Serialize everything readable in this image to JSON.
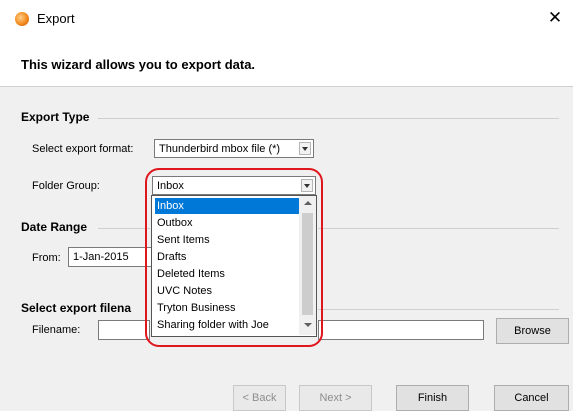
{
  "window": {
    "title": "Export",
    "close_symbol": "✕"
  },
  "header": {
    "text": "This wizard allows you to export data."
  },
  "export_type": {
    "section_label": "Export Type",
    "format_label": "Select export format:",
    "format_value": "Thunderbird mbox file (*)",
    "folder_group_label": "Folder Group:",
    "folder_group_value": "Inbox"
  },
  "folder_dropdown": {
    "items": [
      "Inbox",
      "Outbox",
      "Sent Items",
      "Drafts",
      "Deleted Items",
      "UVC Notes",
      "Tryton Business",
      "Sharing folder with Joe"
    ],
    "selected_index": 0
  },
  "date_range": {
    "section_label": "Date Range",
    "from_label": "From:",
    "from_value": "1-Jan-2015"
  },
  "filename_section": {
    "section_label": "Select export filena",
    "filename_label": "Filename:",
    "filename_value": "",
    "browse_label": "Browse"
  },
  "buttons": {
    "back": "< Back",
    "next": "Next >",
    "finish": "Finish",
    "cancel": "Cancel"
  },
  "colors": {
    "selection": "#0078d7",
    "annotation": "#e0161e"
  },
  "icons": {
    "app": "thunderbird-app-icon",
    "close": "close-icon"
  }
}
